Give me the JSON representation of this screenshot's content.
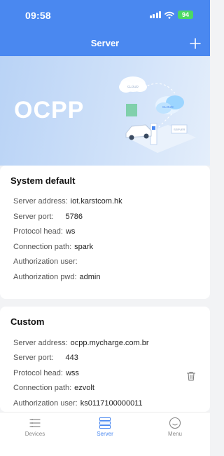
{
  "status_bar": {
    "time": "09:58",
    "battery": "94"
  },
  "header": {
    "title": "Server",
    "add_icon": "plus-icon"
  },
  "banner": {
    "title": "OCPP",
    "cloud_labels": [
      "CLOUD",
      "CLOUD",
      "SERVER"
    ]
  },
  "system_default": {
    "title": "System default",
    "rows": [
      {
        "label": "Server address:",
        "value": "iot.karstcom.hk"
      },
      {
        "label": "Server port:",
        "value": "5786"
      },
      {
        "label": "Protocol head:",
        "value": "ws"
      },
      {
        "label": "Connection path:",
        "value": "spark"
      },
      {
        "label": "Authorization user:",
        "value": ""
      },
      {
        "label": "Authorization pwd:",
        "value": "admin"
      }
    ]
  },
  "custom": {
    "title": "Custom",
    "rows": [
      {
        "label": "Server address:",
        "value": "ocpp.mycharge.com.br"
      },
      {
        "label": "Server port:",
        "value": "443"
      },
      {
        "label": "Protocol head:",
        "value": "wss"
      },
      {
        "label": "Connection path:",
        "value": "ezvolt"
      },
      {
        "label": "Authorization user:",
        "value": "ks0117100000011"
      }
    ],
    "delete_icon": "trash-icon"
  },
  "tabs": [
    {
      "label": "Devices",
      "icon": "list-icon",
      "active": false
    },
    {
      "label": "Server",
      "icon": "server-icon",
      "active": true
    },
    {
      "label": "Menu",
      "icon": "smiley-icon",
      "active": false
    }
  ],
  "colors": {
    "primary": "#4a88f0",
    "tab_active": "#4a88f0",
    "tab_inactive": "#8a8a8a",
    "battery": "#4cd964",
    "background": "#f2f3f5"
  }
}
